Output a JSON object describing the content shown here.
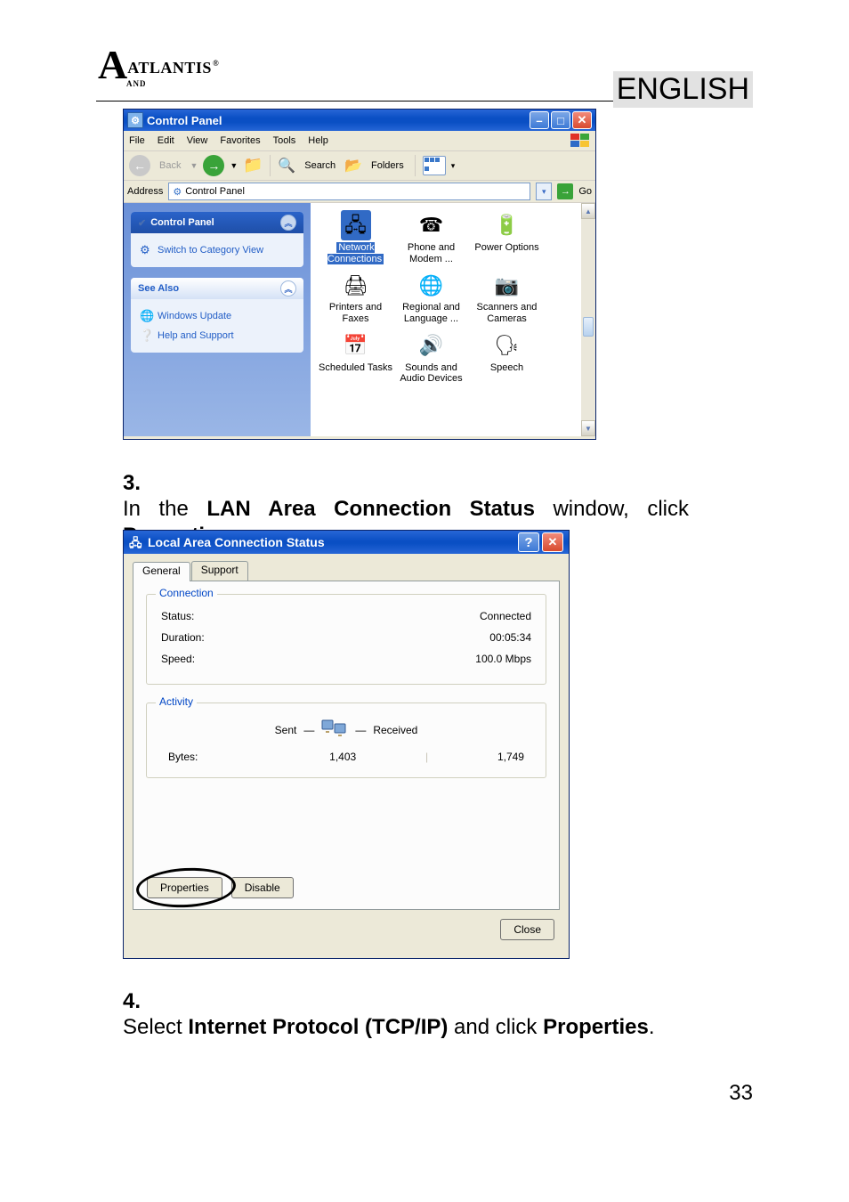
{
  "meta": {
    "brand": "ATLANTIS",
    "brand_sub": "AND",
    "reg_mark": "®",
    "language_badge": "ENGLISH",
    "page_number": "33"
  },
  "step3": {
    "num": "3.",
    "pre": "In the ",
    "bold1": "LAN Area Connection Status",
    "mid": " window, click ",
    "bold2": "Properties",
    "post": "."
  },
  "step4": {
    "num": "4.",
    "pre": "Select ",
    "bold1": "Internet Protocol (TCP/IP)",
    "mid": " and click ",
    "bold2": "Properties",
    "post": "."
  },
  "control_panel": {
    "title": "Control Panel",
    "menu": [
      "File",
      "Edit",
      "View",
      "Favorites",
      "Tools",
      "Help"
    ],
    "toolbar": {
      "back": "Back",
      "search": "Search",
      "folders": "Folders"
    },
    "address_label": "Address",
    "address_value": "Control Panel",
    "go": "Go",
    "side": {
      "panel1_title": "Control Panel",
      "panel1_link": "Switch to Category View",
      "panel2_title": "See Also",
      "panel2_links": [
        "Windows Update",
        "Help and Support"
      ]
    },
    "items": [
      {
        "label": "Network Connections",
        "selected": true
      },
      {
        "label": "Phone and Modem ..."
      },
      {
        "label": "Power Options"
      },
      {
        "label": "Printers and Faxes"
      },
      {
        "label": "Regional and Language ..."
      },
      {
        "label": "Scanners and Cameras"
      },
      {
        "label": "Scheduled Tasks"
      },
      {
        "label": "Sounds and Audio Devices"
      },
      {
        "label": "Speech"
      }
    ]
  },
  "status_dialog": {
    "title": "Local Area Connection Status",
    "tabs": [
      "General",
      "Support"
    ],
    "connection": {
      "legend": "Connection",
      "rows": [
        {
          "label": "Status:",
          "value": "Connected"
        },
        {
          "label": "Duration:",
          "value": "00:05:34"
        },
        {
          "label": "Speed:",
          "value": "100.0 Mbps"
        }
      ]
    },
    "activity": {
      "legend": "Activity",
      "sent": "Sent",
      "received": "Received",
      "bytes_label": "Bytes:",
      "bytes_sent": "1,403",
      "bytes_recv": "1,749"
    },
    "buttons": {
      "properties": "Properties",
      "disable": "Disable",
      "close": "Close"
    }
  }
}
